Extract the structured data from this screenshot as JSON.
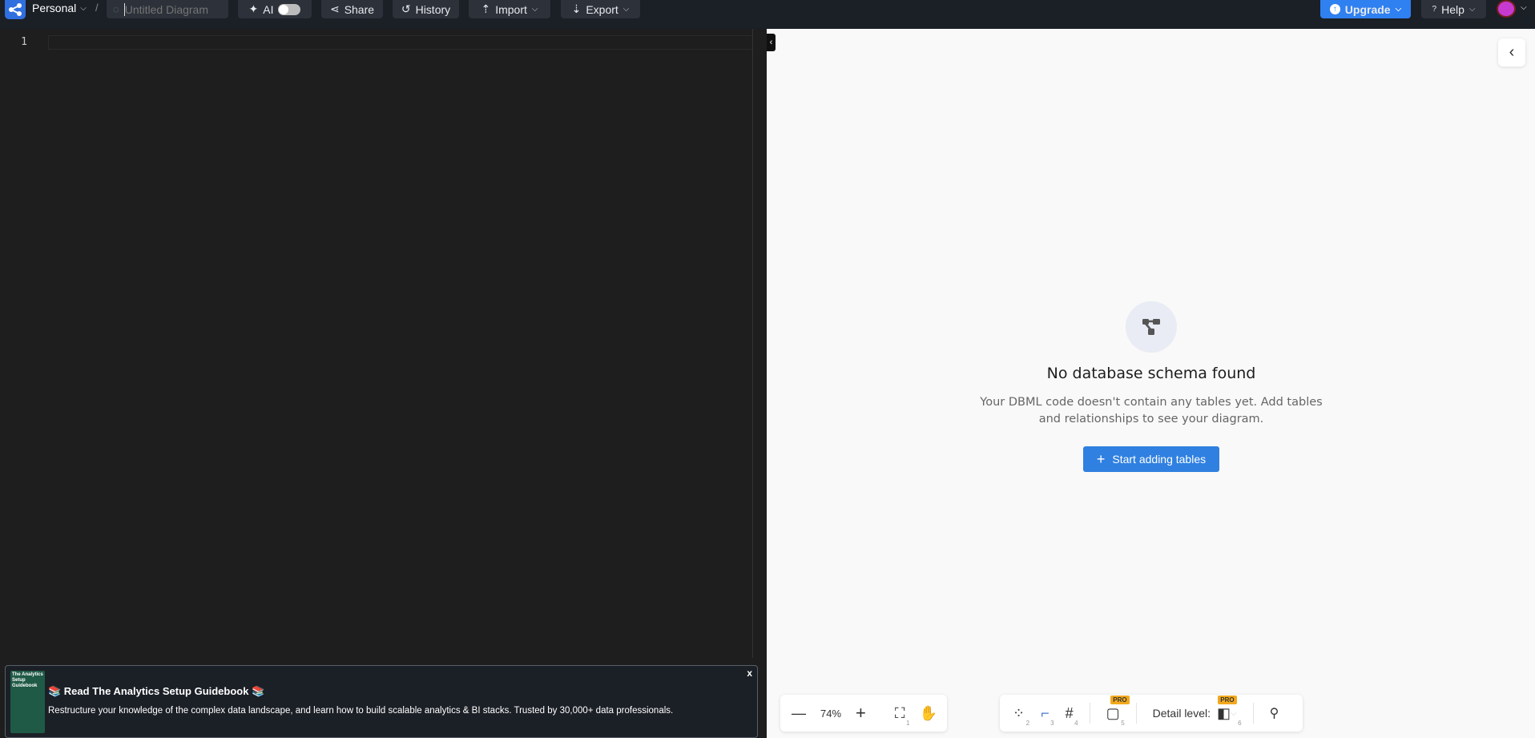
{
  "topbar": {
    "workspace": "Personal",
    "separator": "/",
    "diagram_placeholder": "Untitled Diagram",
    "ai_label": "AI",
    "share": "Share",
    "history": "History",
    "import": "Import",
    "export": "Export",
    "upgrade": "Upgrade",
    "help": "Help"
  },
  "editor": {
    "line_numbers": [
      "1"
    ]
  },
  "empty_state": {
    "title": "No database schema found",
    "description": "Your DBML code doesn't contain any tables yet. Add tables and relationships to see your diagram.",
    "button": "Start adding tables"
  },
  "banner": {
    "title": "📚 Read The Analytics Setup Guidebook 📚",
    "description": "Restructure your knowledge of the complex data landscape, and learn how to build scalable analytics & BI stacks. Trusted by 30,000+ data professionals.",
    "thumb_title": "The Analytics Setup Guidebook",
    "close": "x"
  },
  "zoom_toolbar": {
    "zoom": "74%",
    "shortcut_fit": "1"
  },
  "view_toolbar": {
    "shortcuts": [
      "2",
      "3",
      "4",
      "5",
      "6"
    ],
    "pro": "PRO",
    "detail_label": "Detail level:"
  },
  "colors": {
    "accent": "#2f80e0",
    "topbar": "#1b1f26",
    "editor": "#1e1e1e",
    "canvas": "#f9f9f9",
    "pro": "#f2a81d"
  }
}
